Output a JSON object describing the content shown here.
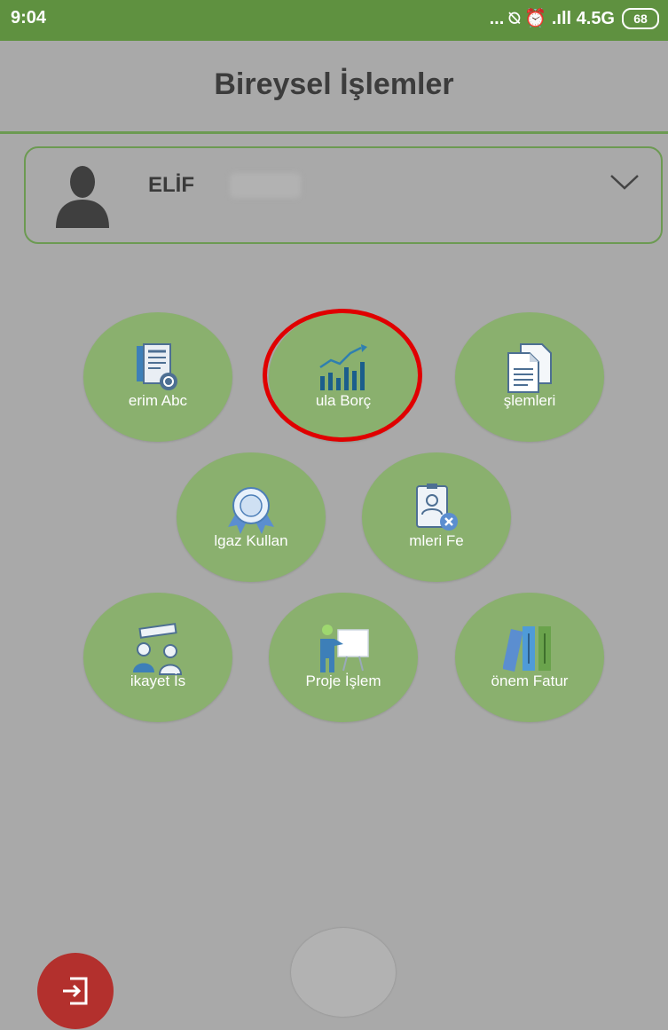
{
  "status_bar": {
    "time": "9:04",
    "indicators": "... ⍉ ⏰ .ıll 4.5G",
    "battery": "68"
  },
  "header": {
    "title": "Bireysel İşlemler"
  },
  "user": {
    "name": "ELİF",
    "dropdown_icon": "chevron-down-icon",
    "avatar_icon": "person-silhouette-icon"
  },
  "menu": {
    "items": [
      {
        "label": "erim   Abc",
        "icon": "document-refresh-icon"
      },
      {
        "label": "ula   Borç",
        "icon": "bar-chart-trend-icon"
      },
      {
        "label": "şlemleri",
        "icon": "documents-icon"
      },
      {
        "label": "lgaz Kullan",
        "icon": "award-badge-icon"
      },
      {
        "label": "mleri   Fe",
        "icon": "id-card-remove-icon"
      },
      {
        "label": "ikayet   İs",
        "icon": "complaint-people-icon"
      },
      {
        "label": "Proje İşlem",
        "icon": "presentation-board-icon"
      },
      {
        "label": "önem Fatur",
        "icon": "binders-icon"
      }
    ],
    "highlighted_index": 1
  },
  "colors": {
    "status_bar": "#5f9140",
    "accent_green": "#6c9a52",
    "menu_circle": "#8ab06e",
    "highlight_ring": "#e00000",
    "logout": "#b3302d"
  },
  "bottom": {
    "logout_icon": "exit-door-icon",
    "home_icon": "home-button"
  }
}
